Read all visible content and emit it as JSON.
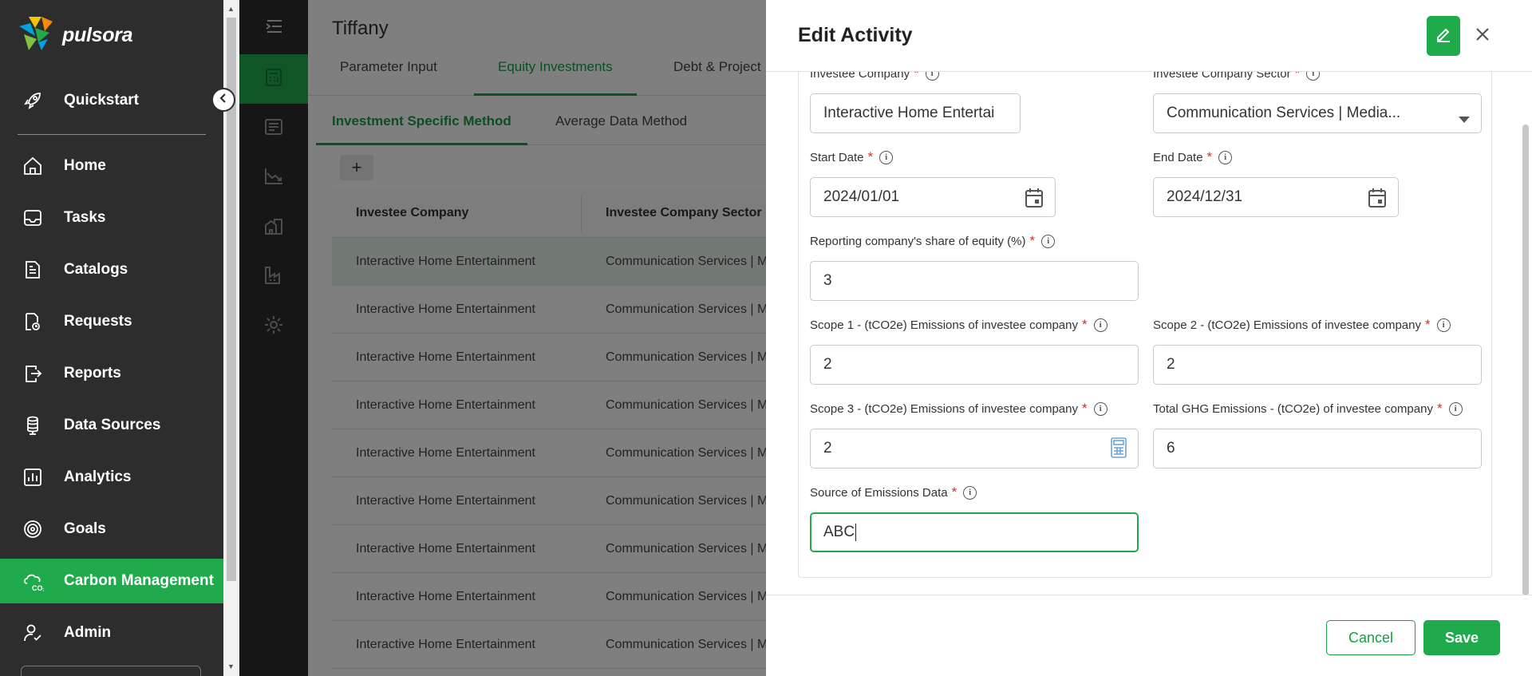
{
  "app": {
    "brand_name": "pulsora"
  },
  "sidebar": {
    "items": [
      {
        "label": "Quickstart",
        "icon": "rocket-icon"
      },
      {
        "label": "Home",
        "icon": "home-icon"
      },
      {
        "label": "Tasks",
        "icon": "inbox-icon"
      },
      {
        "label": "Catalogs",
        "icon": "document-icon"
      },
      {
        "label": "Requests",
        "icon": "requests-icon"
      },
      {
        "label": "Reports",
        "icon": "report-export-icon"
      },
      {
        "label": "Data Sources",
        "icon": "database-icon"
      },
      {
        "label": "Analytics",
        "icon": "bar-chart-icon"
      },
      {
        "label": "Goals",
        "icon": "target-icon"
      },
      {
        "label": "Carbon Management",
        "icon": "carbon-cloud-icon",
        "active": true
      },
      {
        "label": "Admin",
        "icon": "user-admin-icon"
      }
    ]
  },
  "main": {
    "page_title": "Tiffany",
    "tabs": [
      "Parameter Input",
      "Equity Investments",
      "Debt & Project"
    ],
    "active_tab": "Equity Investments",
    "subtabs": [
      "Investment Specific Method",
      "Average Data Method"
    ],
    "active_subtab": "Investment Specific Method",
    "add_label": "+",
    "table": {
      "columns": [
        "Investee Company",
        "Investee Company Sector"
      ],
      "rows": [
        [
          "Interactive Home Entertainment",
          "Communication Services | M"
        ],
        [
          "Interactive Home Entertainment",
          "Communication Services | M"
        ],
        [
          "Interactive Home Entertainment",
          "Communication Services | M"
        ],
        [
          "Interactive Home Entertainment",
          "Communication Services | M"
        ],
        [
          "Interactive Home Entertainment",
          "Communication Services | M"
        ],
        [
          "Interactive Home Entertainment",
          "Communication Services | M"
        ],
        [
          "Interactive Home Entertainment",
          "Communication Services | M"
        ],
        [
          "Interactive Home Entertainment",
          "Communication Services | M"
        ],
        [
          "Interactive Home Entertainment",
          "Communication Services | M"
        ]
      ]
    }
  },
  "drawer": {
    "title": "Edit Activity",
    "fields": {
      "investee_company": {
        "label": "Investee Company",
        "value": "Interactive Home Entertai"
      },
      "investee_sector": {
        "label": "Investee Company Sector",
        "value": "Communication Services | Media..."
      },
      "start_date": {
        "label": "Start Date",
        "value": "2024/01/01"
      },
      "end_date": {
        "label": "End Date",
        "value": "2024/12/31"
      },
      "equity_share": {
        "label": "Reporting company's share of equity (%)",
        "value": "3"
      },
      "scope1": {
        "label": "Scope 1 - (tCO2e) Emissions of investee company",
        "value": "2"
      },
      "scope2": {
        "label": "Scope 2 - (tCO2e) Emissions of investee company",
        "value": "2"
      },
      "scope3": {
        "label": "Scope 3 - (tCO2e) Emissions of investee company",
        "value": "2"
      },
      "total_ghg": {
        "label": "Total GHG Emissions - (tCO2e) of investee company",
        "value": "6"
      },
      "source": {
        "label": "Source of Emissions Data",
        "value": "ABC"
      }
    },
    "required_mark": "*",
    "info_glyph": "i",
    "cancel_label": "Cancel",
    "save_label": "Save"
  },
  "colors": {
    "brand_green": "#1faa4b",
    "sidebar_bg": "#2d2d2d",
    "required_red": "#d32f2f"
  }
}
